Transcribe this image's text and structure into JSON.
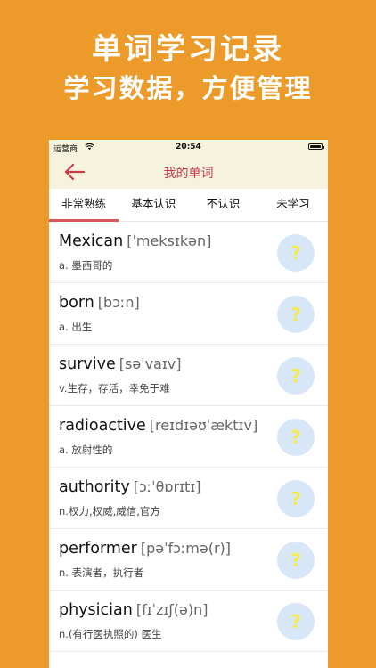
{
  "promo": {
    "title": "单词学习记录",
    "subtitle": "学习数据，方便管理"
  },
  "status_bar": {
    "carrier": "运营商",
    "time": "20:54"
  },
  "nav": {
    "title": "我的单词"
  },
  "tabs": [
    {
      "label": "非常熟练",
      "active": true
    },
    {
      "label": "基本认识",
      "active": false
    },
    {
      "label": "不认识",
      "active": false
    },
    {
      "label": "未学习",
      "active": false
    }
  ],
  "words": [
    {
      "word": "Mexican",
      "phonetic": "[ˈmeksɪkən]",
      "meaning": "a. 墨西哥的",
      "status": "?"
    },
    {
      "word": "born",
      "phonetic": "[bɔːn]",
      "meaning": "a. 出生",
      "status": "?"
    },
    {
      "word": "survive",
      "phonetic": "[səˈvaɪv]",
      "meaning": "v.生存，存活，幸免于难",
      "status": "?"
    },
    {
      "word": "radioactive",
      "phonetic": "[reɪdɪəʊˈæktɪv]",
      "meaning": "a. 放射性的",
      "status": "?"
    },
    {
      "word": "authority",
      "phonetic": "[ɔːˈθɒrɪtɪ]",
      "meaning": "n.权力,权威,威信,官方",
      "status": "?"
    },
    {
      "word": "performer",
      "phonetic": "[pəˈfɔːmə(r)]",
      "meaning": "n. 表演者，执行者",
      "status": "?"
    },
    {
      "word": "physician",
      "phonetic": "[fɪˈzɪʃ(ə)n]",
      "meaning": "n.(有行医执照的) 医生",
      "status": "?"
    }
  ],
  "colors": {
    "background": "#ec9b2b",
    "nav_background": "#f5f3dd",
    "accent": "#c93a4a",
    "tab_indicator": "#d9575d",
    "status_circle": "#d7e7f7",
    "question_mark": "#f6e94c"
  },
  "icons": {
    "back": "arrow-left-icon",
    "wifi": "wifi-icon",
    "battery": "battery-icon"
  }
}
